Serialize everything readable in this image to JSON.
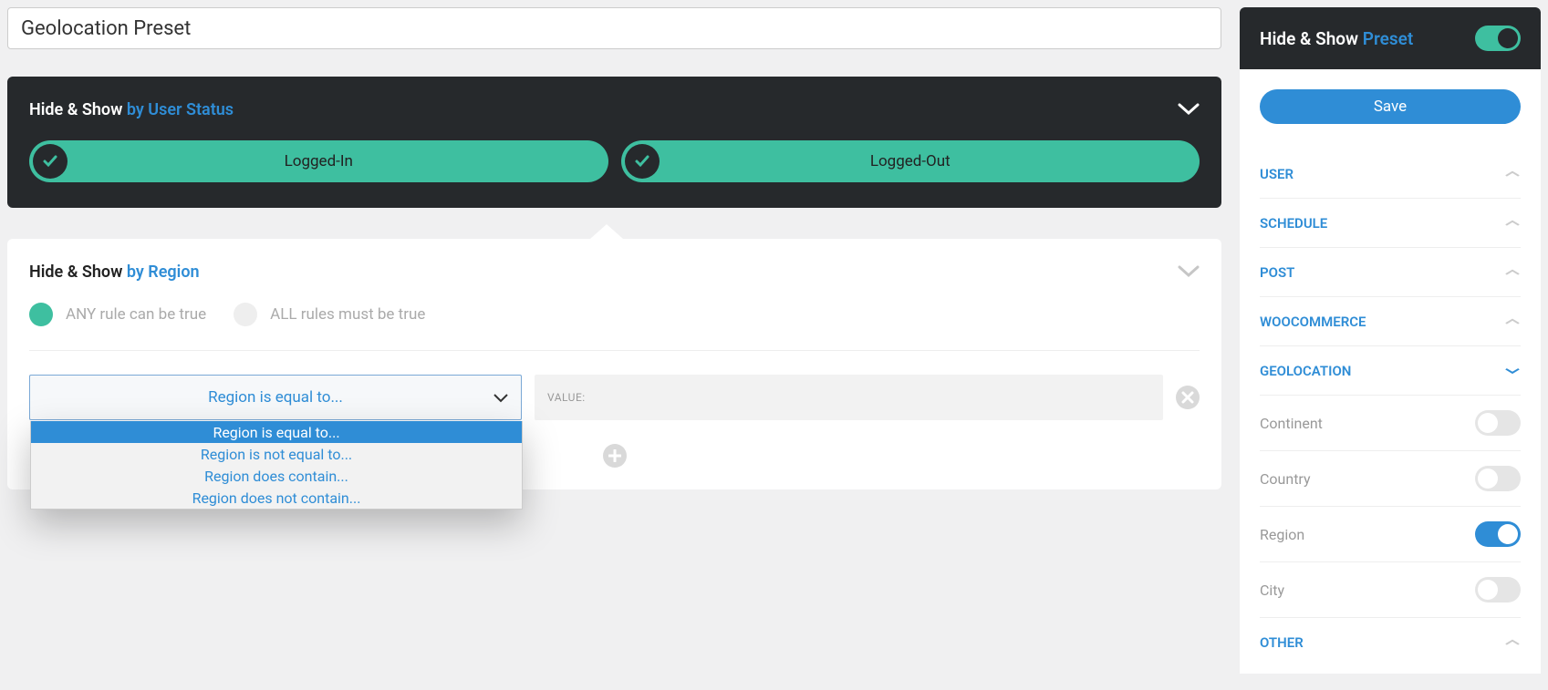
{
  "title_value": "Geolocation Preset",
  "user_status_panel": {
    "prefix": "Hide & Show ",
    "suffix": "by User Status",
    "logged_in": "Logged-In",
    "logged_out": "Logged-Out"
  },
  "region_panel": {
    "prefix": "Hide & Show ",
    "suffix": "by Region",
    "any_rule": "ANY rule can be true",
    "all_rules": "ALL rules must be true",
    "select_value": "Region is equal to...",
    "value_placeholder": "VALUE:",
    "options": [
      "Region is equal to...",
      "Region is not equal to...",
      "Region does contain...",
      "Region does not contain..."
    ]
  },
  "sidebar": {
    "header_prefix": "Hide & Show ",
    "header_suffix": "Preset",
    "save": "Save",
    "sections": {
      "user": "USER",
      "schedule": "SCHEDULE",
      "post": "POST",
      "woocommerce": "WOOCOMMERCE",
      "geolocation": "GEOLOCATION",
      "other": "OTHER"
    },
    "geo_items": {
      "continent": "Continent",
      "country": "Country",
      "region": "Region",
      "city": "City"
    }
  }
}
